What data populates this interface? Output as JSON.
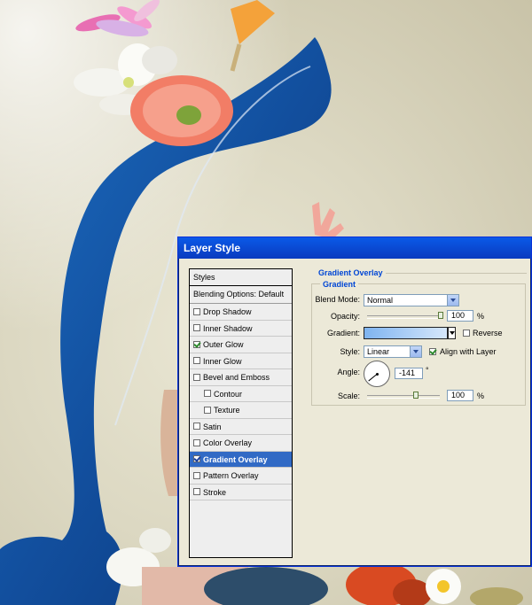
{
  "dialog": {
    "title": "Layer Style"
  },
  "styles_list": {
    "header": "Styles",
    "blending": "Blending Options: Default",
    "items": [
      {
        "label": "Drop Shadow",
        "checked": false,
        "indent": false,
        "selected": false
      },
      {
        "label": "Inner Shadow",
        "checked": false,
        "indent": false,
        "selected": false
      },
      {
        "label": "Outer Glow",
        "checked": true,
        "indent": false,
        "selected": false
      },
      {
        "label": "Inner Glow",
        "checked": false,
        "indent": false,
        "selected": false
      },
      {
        "label": "Bevel and Emboss",
        "checked": false,
        "indent": false,
        "selected": false
      },
      {
        "label": "Contour",
        "checked": false,
        "indent": true,
        "selected": false
      },
      {
        "label": "Texture",
        "checked": false,
        "indent": true,
        "selected": false
      },
      {
        "label": "Satin",
        "checked": false,
        "indent": false,
        "selected": false
      },
      {
        "label": "Color Overlay",
        "checked": false,
        "indent": false,
        "selected": false
      },
      {
        "label": "Gradient Overlay",
        "checked": true,
        "indent": false,
        "selected": true
      },
      {
        "label": "Pattern Overlay",
        "checked": false,
        "indent": false,
        "selected": false
      },
      {
        "label": "Stroke",
        "checked": false,
        "indent": false,
        "selected": false
      }
    ]
  },
  "gradient_overlay": {
    "section_title": "Gradient Overlay",
    "group_title": "Gradient",
    "blend_mode_label": "Blend Mode:",
    "blend_mode_value": "Normal",
    "opacity_label": "Opacity:",
    "opacity_value": "100",
    "opacity_fraction": 1.0,
    "percent": "%",
    "gradient_label": "Gradient:",
    "reverse_label": "Reverse",
    "reverse_checked": false,
    "style_label": "Style:",
    "style_value": "Linear",
    "align_label": "Align with Layer",
    "align_checked": true,
    "angle_label": "Angle:",
    "angle_value": "-141",
    "degree": "°",
    "scale_label": "Scale:",
    "scale_value": "100",
    "scale_fraction": 0.67,
    "gradient_colors": [
      "#7fb4f0",
      "#d6e7fb"
    ]
  },
  "colors": {
    "selection": "#316ac5",
    "titlebar": "#0a4ad3",
    "section_title": "#0046d5"
  }
}
